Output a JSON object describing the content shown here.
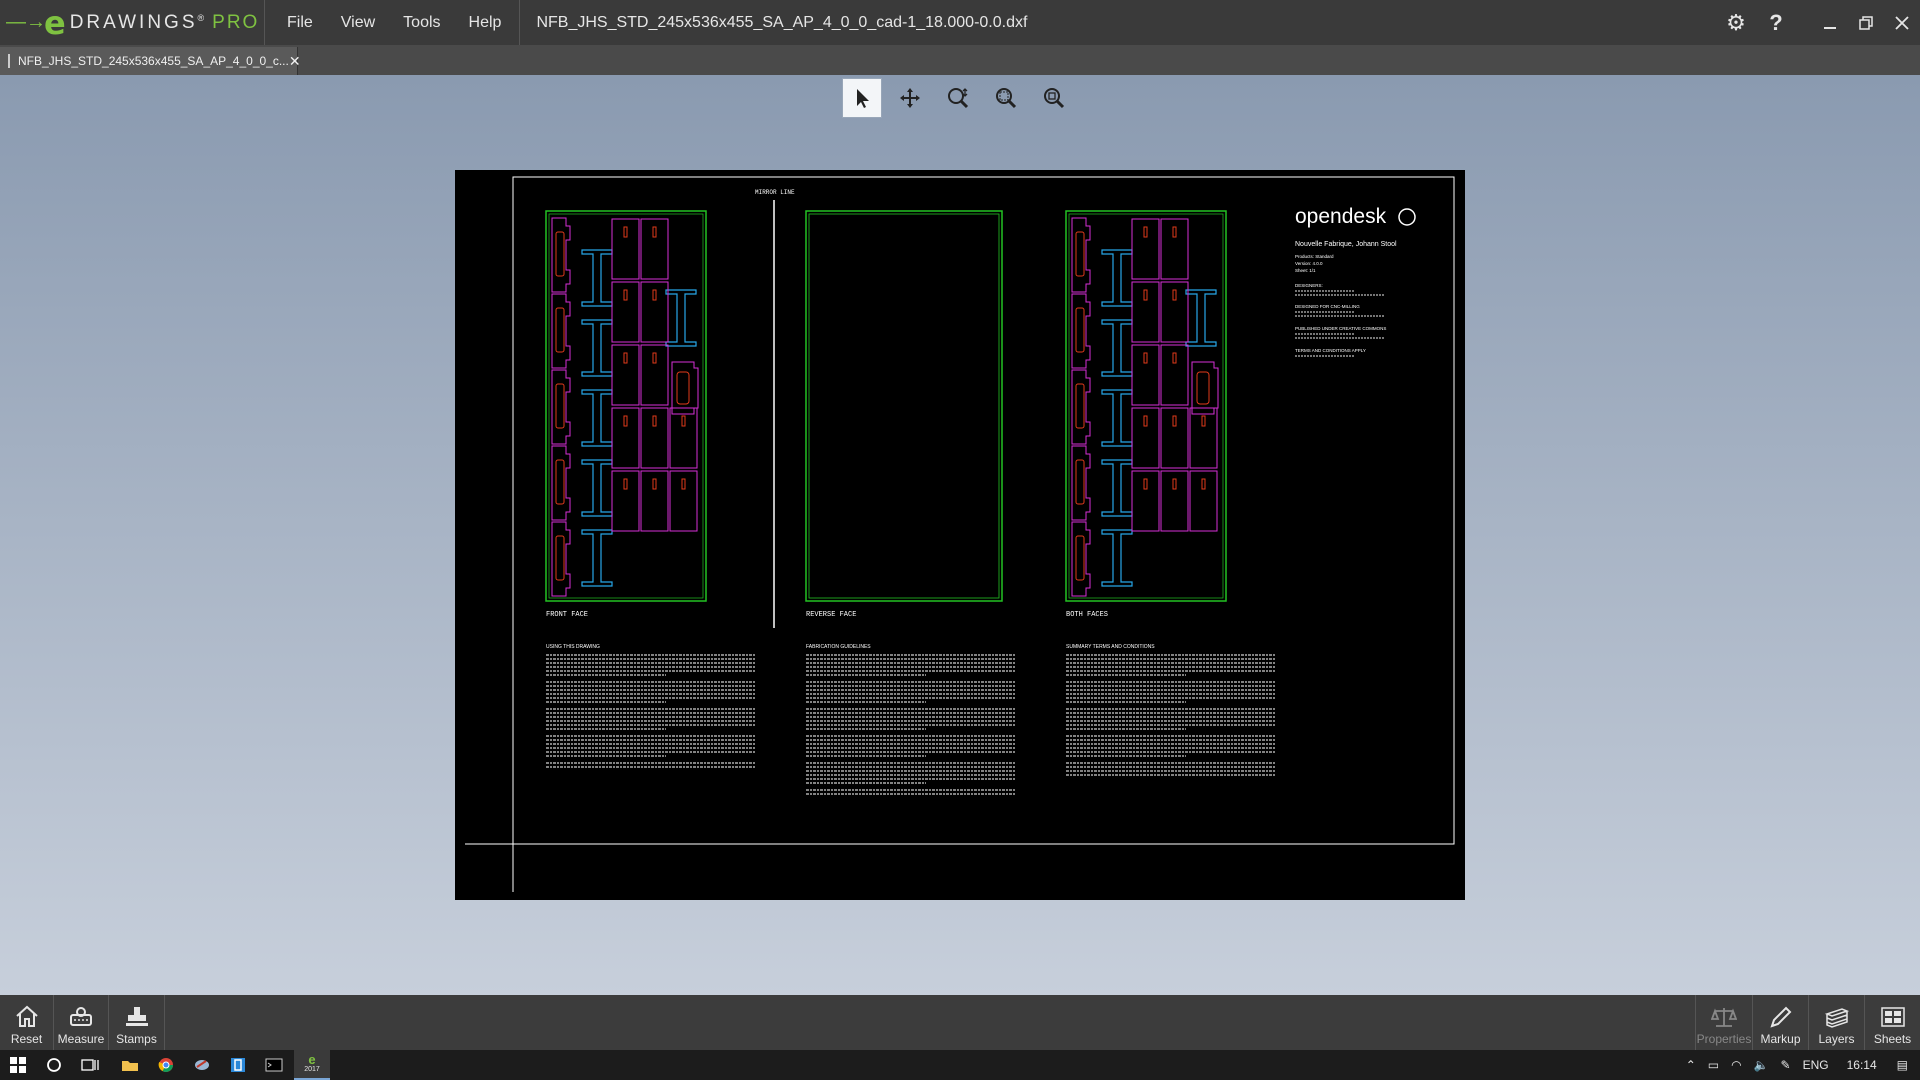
{
  "app": {
    "name": "DRAWINGS",
    "edition": "PRO"
  },
  "menu": {
    "file": "File",
    "view": "View",
    "tools": "Tools",
    "help": "Help"
  },
  "window_title": "NFB_JHS_STD_245x536x455_SA_AP_4_0_0_cad-1_18.000-0.0.dxf",
  "tab": {
    "label": "NFB_JHS_STD_245x536x455_SA_AP_4_0_0_c..."
  },
  "view_toolbar": [
    "select-arrow-icon",
    "pan-icon",
    "zoom-icon",
    "zoom-to-area-icon",
    "zoom-to-fit-icon"
  ],
  "drawing": {
    "mirror_line": "MIRROR LINE",
    "front_face": "FRONT FACE",
    "reverse_face": "REVERSE FACE",
    "both_faces": "BOTH FACES",
    "brand": "opendesk",
    "product": "Nouvelle Fabrique, Johann Stool",
    "meta": [
      "Products: Standard",
      "Version: 4.0.0",
      "Sheet: 1/1"
    ],
    "designers_heading": "DESIGNERS:",
    "cnc_heading": "DESIGNED FOR CNC-MILLING",
    "license_heading": "PUBLISHED UNDER CREATIVE COMMONS",
    "terms_heading": "TERMS AND CONDITIONS APPLY",
    "notes_headings": [
      "USING THIS DRAWING",
      "FABRICATION GUIDELINES",
      "SUMMARY TERMS AND CONDITIONS"
    ],
    "colors": {
      "sheet": "#22c322",
      "outline": "#d62fd6",
      "pocket": "#e03a1a",
      "leg": "#27a7e8",
      "border": "#ffffff"
    }
  },
  "bottom_toolbar": {
    "reset": "Reset",
    "measure": "Measure",
    "stamps": "Stamps",
    "properties": "Properties",
    "markup": "Markup",
    "layers": "Layers",
    "sheets": "Sheets"
  },
  "taskbar": {
    "language": "ENG",
    "time": "16:14",
    "app_badge": "2017"
  }
}
